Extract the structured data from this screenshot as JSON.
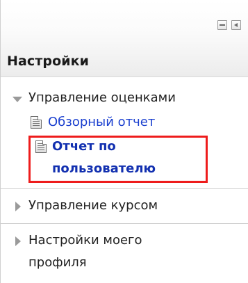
{
  "block": {
    "title": "Настройки",
    "controls": {
      "hide_icon": "minus-box-icon",
      "dock_icon": "dock-left-arrow-icon"
    }
  },
  "tree": {
    "grades": {
      "label": "Управление оценками",
      "expanded": true,
      "items": [
        {
          "label": "Обзорный отчет",
          "icon": "report-document-icon"
        },
        {
          "label_line1": "Отчет по",
          "label_line2": "пользователю",
          "icon": "report-document-icon",
          "highlighted": true,
          "highlight_color": "#ee1c1c"
        }
      ]
    },
    "course": {
      "label": "Управление курсом",
      "expanded": false
    },
    "profile": {
      "label_line1": "Настройки моего",
      "label_line2": "профиля",
      "expanded": false
    }
  },
  "colors": {
    "link": "#1a3fcf",
    "highlight": "#ee1c1c"
  }
}
